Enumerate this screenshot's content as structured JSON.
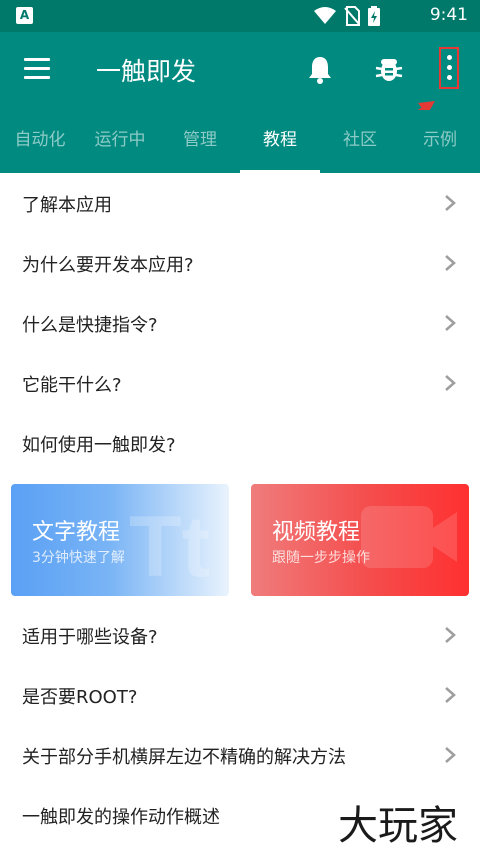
{
  "status_bar": {
    "badge": "A",
    "time": "9:41",
    "icons": [
      "wifi-icon",
      "no-sim-icon",
      "battery-charging-icon"
    ]
  },
  "app_bar": {
    "title": "一触即发",
    "icons": [
      "menu-icon",
      "bell-icon",
      "bug-icon",
      "more-vertical-icon"
    ],
    "color": "#008a80",
    "highlight_color": "#e53935"
  },
  "tabs": [
    {
      "label": "自动化",
      "active": false
    },
    {
      "label": "运行中",
      "active": false
    },
    {
      "label": "管理",
      "active": false
    },
    {
      "label": "教程",
      "active": true
    },
    {
      "label": "社区",
      "active": false
    },
    {
      "label": "示例",
      "active": false
    }
  ],
  "list_top": [
    {
      "label": "了解本应用",
      "chevron": true
    },
    {
      "label": "为什么要开发本应用?",
      "chevron": true
    },
    {
      "label": "什么是快捷指令?",
      "chevron": true
    },
    {
      "label": "它能干什么?",
      "chevron": true
    },
    {
      "label": "如何使用一触即发?",
      "chevron": false
    }
  ],
  "cards": {
    "text": {
      "title": "文字教程",
      "subtitle": "3分钟快速了解",
      "bg_glyph": "Tt"
    },
    "video": {
      "title": "视频教程",
      "subtitle": "跟随一步步操作"
    }
  },
  "list_bottom": [
    {
      "label": "适用于哪些设备?",
      "chevron": true
    },
    {
      "label": "是否要ROOT?",
      "chevron": true
    },
    {
      "label": "关于部分手机横屏左边不精确的解决方法",
      "chevron": true
    },
    {
      "label": "一触即发的操作动作概述",
      "chevron": false
    }
  ],
  "watermark": "大玩家"
}
